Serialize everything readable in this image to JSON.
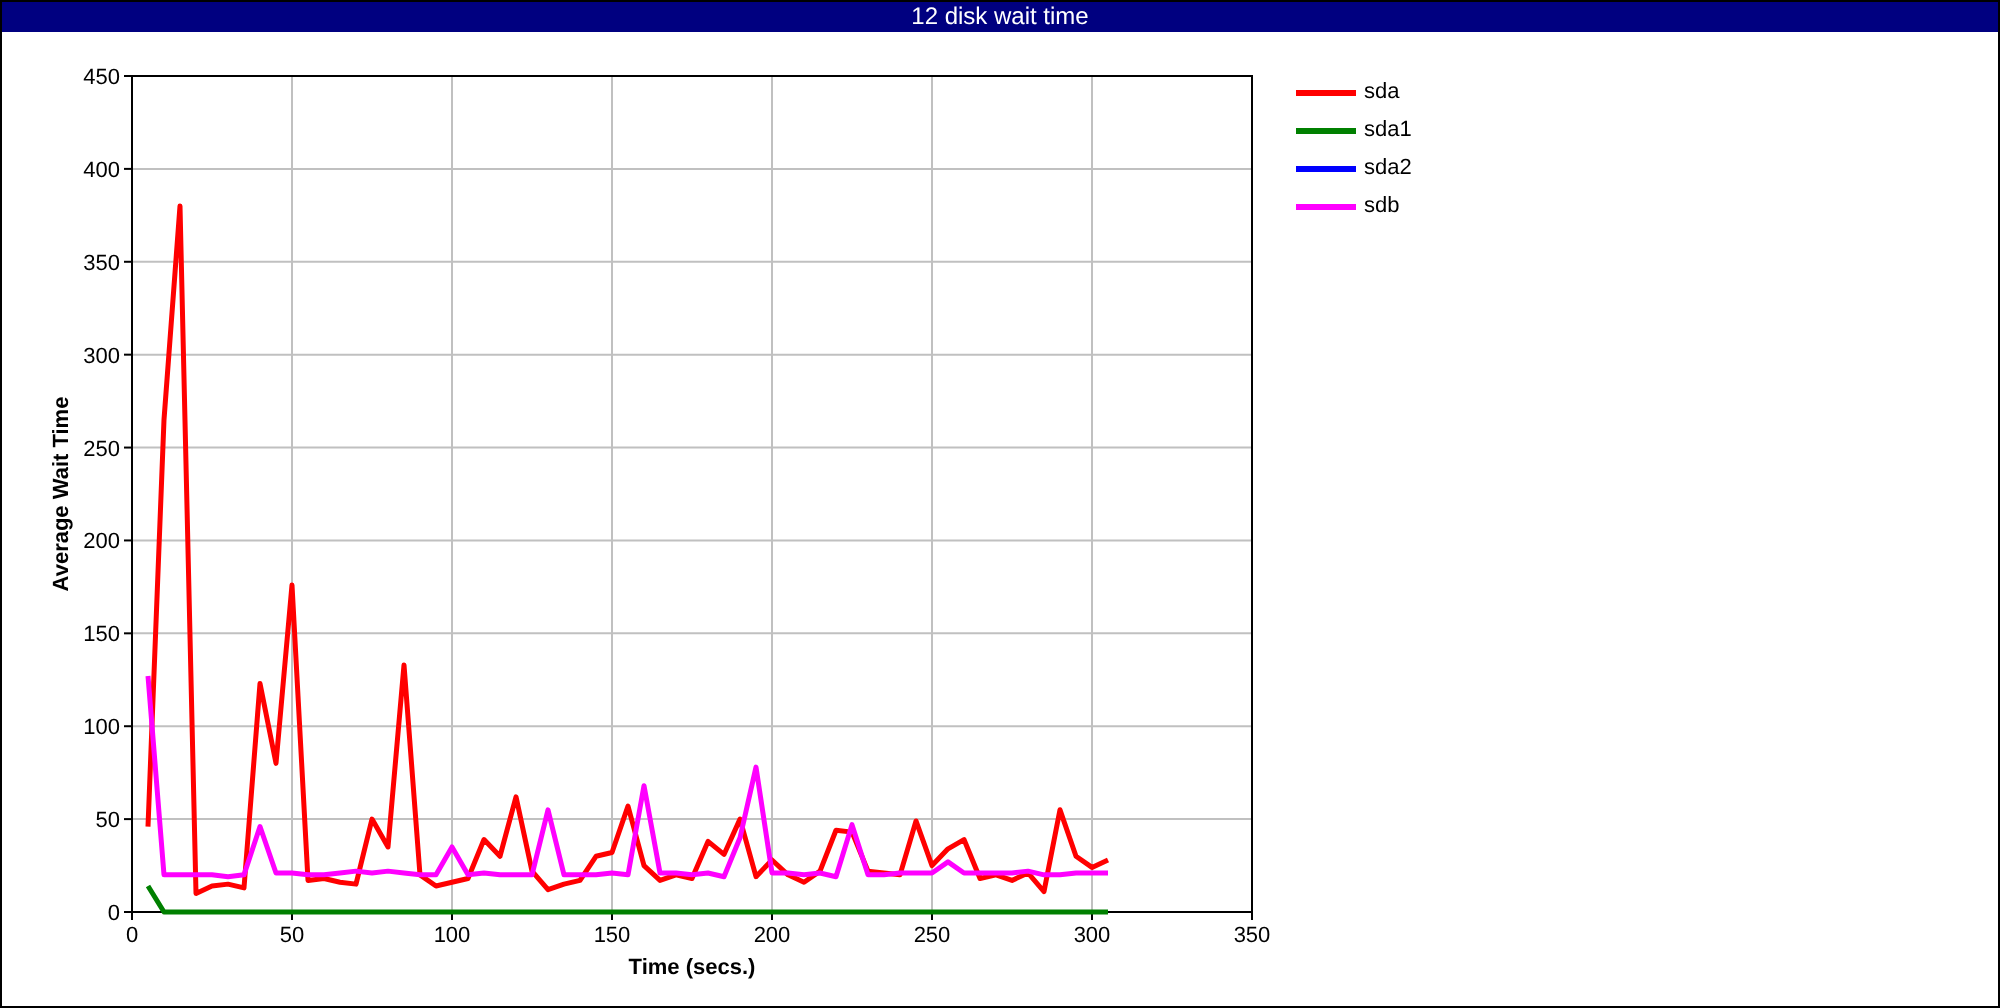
{
  "window": {
    "title": "12 disk wait time"
  },
  "chart_data": {
    "type": "line",
    "grid": true,
    "xlabel": "Time (secs.)",
    "ylabel": "Average Wait Time",
    "xlim": [
      0,
      350
    ],
    "ylim": [
      0,
      450
    ],
    "xticks": [
      0,
      50,
      100,
      150,
      200,
      250,
      300,
      350
    ],
    "yticks": [
      0,
      50,
      100,
      150,
      200,
      250,
      300,
      350,
      400,
      450
    ],
    "x": [
      5,
      10,
      15,
      20,
      25,
      30,
      35,
      40,
      45,
      50,
      55,
      60,
      65,
      70,
      75,
      80,
      85,
      90,
      95,
      100,
      105,
      110,
      115,
      120,
      125,
      130,
      135,
      140,
      145,
      150,
      155,
      160,
      165,
      170,
      175,
      180,
      185,
      190,
      195,
      200,
      205,
      210,
      215,
      220,
      225,
      230,
      235,
      240,
      245,
      250,
      255,
      260,
      265,
      270,
      275,
      280,
      285,
      290,
      295,
      300,
      305
    ],
    "series": [
      {
        "name": "sda",
        "color": "#ff0000",
        "values": [
          46,
          265,
          380,
          10,
          14,
          15,
          13,
          123,
          80,
          176,
          17,
          18,
          16,
          15,
          50,
          35,
          133,
          20,
          14,
          16,
          18,
          39,
          30,
          62,
          22,
          12,
          15,
          17,
          30,
          32,
          57,
          25,
          17,
          20,
          18,
          38,
          31,
          50,
          19,
          28,
          20,
          16,
          22,
          44,
          43,
          22,
          21,
          20,
          49,
          25,
          34,
          39,
          18,
          20,
          17,
          21,
          11,
          55,
          30,
          24,
          28
        ]
      },
      {
        "name": "sda1",
        "color": "#008000",
        "values": [
          14,
          0,
          0,
          0,
          0,
          0,
          0,
          0,
          0,
          0,
          0,
          0,
          0,
          0,
          0,
          0,
          0,
          0,
          0,
          0,
          0,
          0,
          0,
          0,
          0,
          0,
          0,
          0,
          0,
          0,
          0,
          0,
          0,
          0,
          0,
          0,
          0,
          0,
          0,
          0,
          0,
          0,
          0,
          0,
          0,
          0,
          0,
          0,
          0,
          0,
          0,
          0,
          0,
          0,
          0,
          0,
          0,
          0,
          0,
          0,
          0
        ]
      },
      {
        "name": "sda2",
        "color": "#0000ff",
        "values": [
          null,
          null,
          null,
          null,
          null,
          null,
          null,
          null,
          null,
          null,
          null,
          null,
          null,
          null,
          null,
          null,
          null,
          null,
          null,
          null,
          null,
          null,
          null,
          null,
          null,
          null,
          null,
          null,
          null,
          null,
          null,
          null,
          null,
          null,
          null,
          null,
          null,
          null,
          null,
          null,
          null,
          null,
          null,
          null,
          null,
          null,
          null,
          null,
          null,
          null,
          null,
          null,
          null,
          null,
          null,
          null,
          null,
          null,
          null,
          null,
          null
        ]
      },
      {
        "name": "sdb",
        "color": "#ff00ff",
        "values": [
          127,
          20,
          20,
          20,
          20,
          19,
          20,
          46,
          21,
          21,
          20,
          20,
          21,
          22,
          21,
          22,
          21,
          20,
          20,
          35,
          20,
          21,
          20,
          20,
          20,
          55,
          20,
          20,
          20,
          21,
          20,
          68,
          21,
          21,
          20,
          21,
          19,
          40,
          78,
          21,
          21,
          20,
          21,
          19,
          47,
          20,
          20,
          21,
          21,
          21,
          27,
          21,
          21,
          21,
          21,
          22,
          20,
          20,
          21,
          21,
          21
        ]
      }
    ]
  }
}
